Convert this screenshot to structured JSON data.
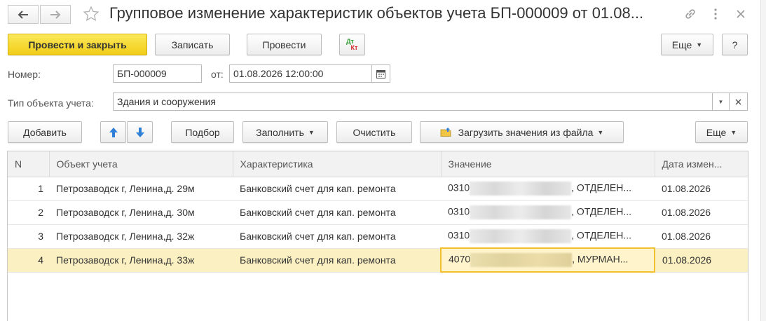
{
  "window": {
    "title": "Групповое изменение характеристик объектов учета БП-000009 от 01.08..."
  },
  "toolbar": {
    "post_close_label": "Провести и закрыть",
    "save_label": "Записать",
    "post_label": "Провести",
    "dtkt_top": "Дт",
    "dtkt_bottom": "Кт",
    "more_label": "Еще",
    "help_label": "?"
  },
  "form": {
    "number_label": "Номер:",
    "number_value": "БП-000009",
    "date_label": "от:",
    "date_value": "01.08.2026 12:00:00",
    "object_type_label": "Тип объекта учета:",
    "object_type_value": "Здания и сооружения"
  },
  "table_toolbar": {
    "add_label": "Добавить",
    "select_label": "Подбор",
    "fill_label": "Заполнить",
    "clear_label": "Очистить",
    "load_label": "Загрузить значения из файла",
    "more_label": "Еще"
  },
  "table": {
    "columns": [
      "N",
      "Объект учета",
      "Характеристика",
      "Значение",
      "Дата измен..."
    ],
    "rows": [
      {
        "n": "1",
        "object": "Петрозаводск г, Ленина,д. 29м",
        "characteristic": "Банковский счет для кап. ремонта",
        "value_prefix": "0310",
        "value_suffix": ", ОТДЕЛЕН...",
        "date": "01.08.2026"
      },
      {
        "n": "2",
        "object": "Петрозаводск г, Ленина,д. 30м",
        "characteristic": "Банковский счет для кап. ремонта",
        "value_prefix": "0310",
        "value_suffix": ", ОТДЕЛЕН...",
        "date": "01.08.2026"
      },
      {
        "n": "3",
        "object": "Петрозаводск г, Ленина,д. 32ж",
        "characteristic": "Банковский счет для кап. ремонта",
        "value_prefix": "0310",
        "value_suffix": ", ОТДЕЛЕН...",
        "date": "01.08.2026"
      },
      {
        "n": "4",
        "object": "Петрозаводск г, Ленина,д. 33ж",
        "characteristic": "Банковский счет для кап. ремонта",
        "value_prefix": "4070",
        "value_suffix": ", МУРМАН...",
        "date": "01.08.2026"
      }
    ]
  },
  "colors": {
    "primary_button": "#f2cd17",
    "selected_row": "#fbf0c2",
    "arrow_blue": "#2f7fd6"
  }
}
